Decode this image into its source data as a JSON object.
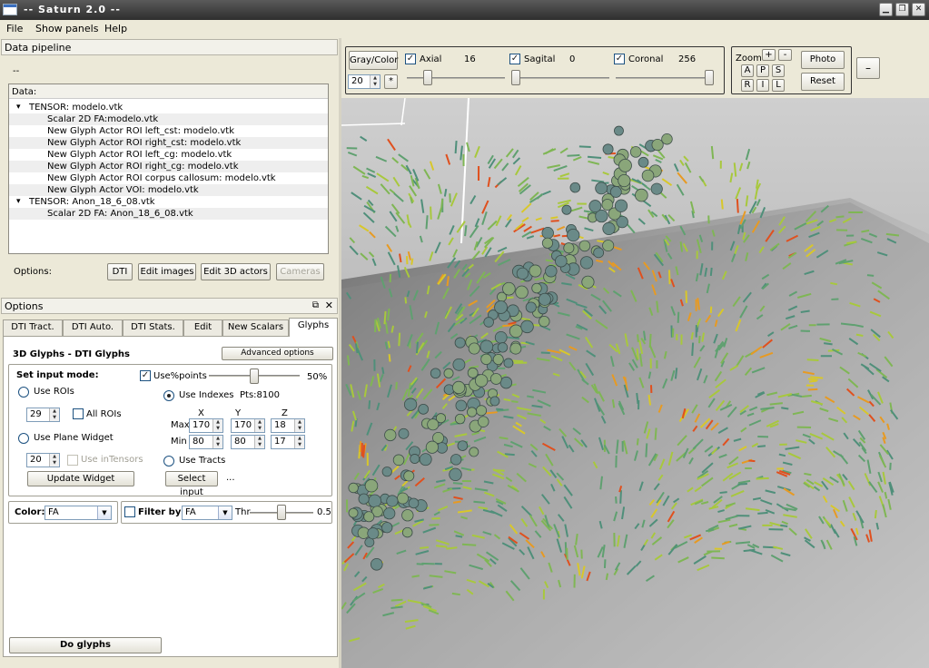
{
  "window": {
    "title": "-- Saturn 2.0 --"
  },
  "menu": [
    "File",
    "Show panels",
    "Help"
  ],
  "pipeline": {
    "header": "Data pipeline",
    "status": "--",
    "data_label": "Data:",
    "tree": [
      {
        "text": "TENSOR: modelo.vtk",
        "level": 0,
        "expander": "-"
      },
      {
        "text": "Scalar 2D FA:modelo.vtk",
        "level": 1
      },
      {
        "text": "New Glyph Actor ROI left_cst: modelo.vtk",
        "level": 1
      },
      {
        "text": "New Glyph Actor ROI right_cst: modelo.vtk",
        "level": 1
      },
      {
        "text": "New Glyph Actor ROI left_cg: modelo.vtk",
        "level": 1
      },
      {
        "text": "New Glyph Actor ROI right_cg: modelo.vtk",
        "level": 1
      },
      {
        "text": "New Glyph Actor ROI corpus callosum: modelo.vtk",
        "level": 1
      },
      {
        "text": "New Glyph Actor VOI: modelo.vtk",
        "level": 1
      },
      {
        "text": "TENSOR: Anon_18_6_08.vtk",
        "level": 0,
        "expander": "-"
      },
      {
        "text": "Scalar 2D FA: Anon_18_6_08.vtk",
        "level": 1
      }
    ],
    "options_label": "Options:",
    "buttons": {
      "dti": "DTI",
      "edit_images": "Edit images",
      "edit_3d": "Edit 3D actors",
      "cameras": "Cameras"
    }
  },
  "options_panel": {
    "header": "Options",
    "tabs": [
      "DTI Tract.",
      "DTI Auto.",
      "DTI Stats.",
      "Edit",
      "New Scalars",
      "Glyphs"
    ],
    "active_tab": "Glyphs",
    "title": "3D Glyphs - DTI Glyphs",
    "advanced_btn": "Advanced options",
    "set_input_mode": "Set input mode:",
    "use_rois": "Use ROIs",
    "roi_value": "29",
    "all_rois": "All ROIs",
    "use_plane_widget": "Use Plane Widget",
    "plane_value": "20",
    "use_in_tensors": "Use inTensors",
    "update_widget": "Update Widget",
    "use_pct_points": "Use%points",
    "pct_value": "50%",
    "pct_fraction": 0.5,
    "use_indexes": "Use Indexes",
    "pts": "Pts:8100",
    "col_x": "X",
    "col_y": "Y",
    "col_z": "Z",
    "max_label": "Max",
    "min_label": "Min",
    "max": [
      "170",
      "170",
      "18"
    ],
    "min": [
      "80",
      "80",
      "17"
    ],
    "use_tracts": "Use Tracts",
    "select_input": "Select input",
    "ellipsis": "...",
    "color_label": "Color:",
    "color_value": "FA",
    "filter_label": "Filter by:",
    "filter_value": "FA",
    "thr_label": "Thr",
    "thr_value": "0.5",
    "do_glyphs": "Do glyphs"
  },
  "viewer": {
    "gray_color": "Gray/Color",
    "slice_step": "20",
    "star": "*",
    "axial": "Axial",
    "axial_value": "16",
    "axial_fraction": 0.18,
    "sagital": "Sagital",
    "sagital_value": "0",
    "sagital_fraction": 0.0,
    "coronal": "Coronal",
    "coronal_value": "256",
    "coronal_fraction": 1.0,
    "zoom": "Zoom",
    "zoom_in": "+",
    "zoom_out": "-",
    "orient": [
      "A",
      "P",
      "S",
      "R",
      "I",
      "L"
    ],
    "photo": "Photo",
    "reset": "Reset",
    "collapse": "–"
  }
}
